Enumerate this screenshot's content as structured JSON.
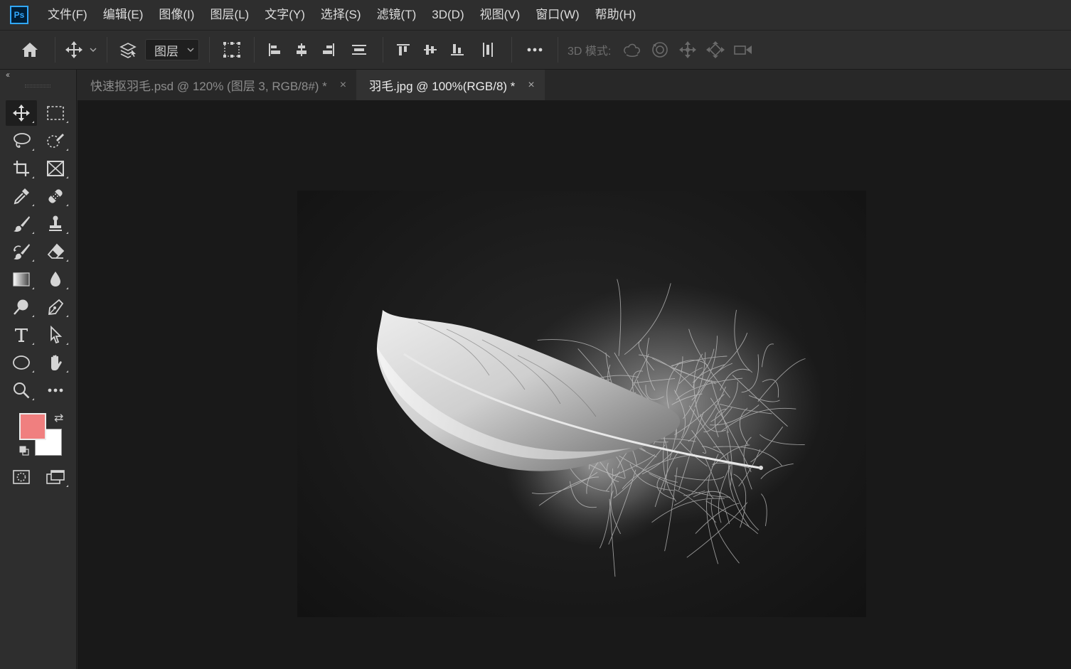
{
  "app": {
    "logo": "Ps"
  },
  "menu": [
    "文件(F)",
    "编辑(E)",
    "图像(I)",
    "图层(L)",
    "文字(Y)",
    "选择(S)",
    "滤镜(T)",
    "3D(D)",
    "视图(V)",
    "窗口(W)",
    "帮助(H)"
  ],
  "options": {
    "auto_select_target": "图层",
    "mode_label": "3D 模式:"
  },
  "tabs": [
    {
      "title": "快速抠羽毛.psd @ 120% (图层 3, RGB/8#) *",
      "close": "×",
      "active": false
    },
    {
      "title": "羽毛.jpg @ 100%(RGB/8) *",
      "close": "×",
      "active": true
    }
  ],
  "toolbox": {
    "collapse": "‹‹",
    "swap": "⇄"
  },
  "colors": {
    "foreground": "#f07f7f",
    "background": "#ffffff",
    "accent": "#31a8ff"
  }
}
